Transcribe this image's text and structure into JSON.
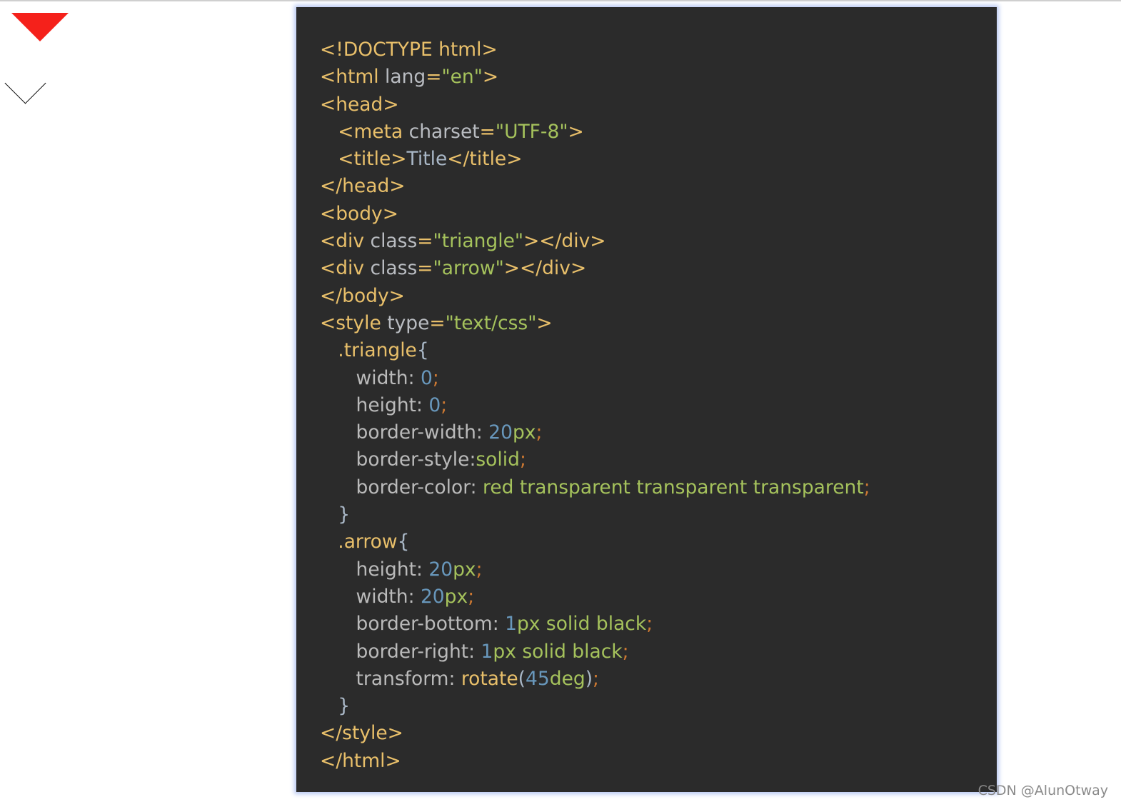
{
  "colors": {
    "triangle_fill": "#f5211b",
    "arrow_stroke": "#111111",
    "code_background": "#2b2b2b",
    "panel_glow": "#b9c9f3"
  },
  "preview": {
    "triangle_icon": "red-triangle-pointing-down",
    "arrow_icon": "chevron-down-outline"
  },
  "code": {
    "lines": [
      [
        {
          "t": "tag",
          "v": "<!DOCTYPE html>"
        }
      ],
      [
        {
          "t": "tag",
          "v": "<html "
        },
        {
          "t": "attr",
          "v": "lang"
        },
        {
          "t": "eq",
          "v": "="
        },
        {
          "t": "str",
          "v": "\"en\""
        },
        {
          "t": "tag",
          "v": ">"
        }
      ],
      [
        {
          "t": "tag",
          "v": "<head>"
        }
      ],
      [
        {
          "t": "tag",
          "v": "   <meta "
        },
        {
          "t": "attr",
          "v": "charset"
        },
        {
          "t": "eq",
          "v": "="
        },
        {
          "t": "str",
          "v": "\"UTF-8\""
        },
        {
          "t": "tag",
          "v": ">"
        }
      ],
      [
        {
          "t": "tag",
          "v": "   <title>"
        },
        {
          "t": "text",
          "v": "Title"
        },
        {
          "t": "tag",
          "v": "</title>"
        }
      ],
      [
        {
          "t": "tag",
          "v": "</head>"
        }
      ],
      [
        {
          "t": "tag",
          "v": "<body>"
        }
      ],
      [
        {
          "t": "tag",
          "v": "<div "
        },
        {
          "t": "attr",
          "v": "class"
        },
        {
          "t": "eq",
          "v": "="
        },
        {
          "t": "str",
          "v": "\"triangle\""
        },
        {
          "t": "tag",
          "v": "></div>"
        }
      ],
      [
        {
          "t": "tag",
          "v": "<div "
        },
        {
          "t": "attr",
          "v": "class"
        },
        {
          "t": "eq",
          "v": "="
        },
        {
          "t": "str",
          "v": "\"arrow\""
        },
        {
          "t": "tag",
          "v": "></div>"
        }
      ],
      [
        {
          "t": "tag",
          "v": "</body>"
        }
      ],
      [
        {
          "t": "tag",
          "v": "<style "
        },
        {
          "t": "attr",
          "v": "type"
        },
        {
          "t": "eq",
          "v": "="
        },
        {
          "t": "str",
          "v": "\"text/css\""
        },
        {
          "t": "tag",
          "v": ">"
        }
      ],
      [
        {
          "t": "sel",
          "v": "   .triangle"
        },
        {
          "t": "brace",
          "v": "{"
        }
      ],
      [
        {
          "t": "prop",
          "v": "      width: "
        },
        {
          "t": "num",
          "v": "0"
        },
        {
          "t": "semi",
          "v": ";"
        }
      ],
      [
        {
          "t": "prop",
          "v": "      height: "
        },
        {
          "t": "num",
          "v": "0"
        },
        {
          "t": "semi",
          "v": ";"
        }
      ],
      [
        {
          "t": "prop",
          "v": "      border-width: "
        },
        {
          "t": "num",
          "v": "20"
        },
        {
          "t": "unit",
          "v": "px"
        },
        {
          "t": "semi",
          "v": ";"
        }
      ],
      [
        {
          "t": "prop",
          "v": "      border-style:"
        },
        {
          "t": "val",
          "v": "solid"
        },
        {
          "t": "semi",
          "v": ";"
        }
      ],
      [
        {
          "t": "prop",
          "v": "      border-color: "
        },
        {
          "t": "val",
          "v": "red transparent transparent transparent"
        },
        {
          "t": "semi",
          "v": ";"
        }
      ],
      [
        {
          "t": "brace",
          "v": "   }"
        }
      ],
      [
        {
          "t": "sel",
          "v": "   .arrow"
        },
        {
          "t": "brace",
          "v": "{"
        }
      ],
      [
        {
          "t": "prop",
          "v": "      height: "
        },
        {
          "t": "num",
          "v": "20"
        },
        {
          "t": "unit",
          "v": "px"
        },
        {
          "t": "semi",
          "v": ";"
        }
      ],
      [
        {
          "t": "prop",
          "v": "      width: "
        },
        {
          "t": "num",
          "v": "20"
        },
        {
          "t": "unit",
          "v": "px"
        },
        {
          "t": "semi",
          "v": ";"
        }
      ],
      [
        {
          "t": "prop",
          "v": "      border-bottom: "
        },
        {
          "t": "num",
          "v": "1"
        },
        {
          "t": "val",
          "v": "px solid black"
        },
        {
          "t": "semi",
          "v": ";"
        }
      ],
      [
        {
          "t": "prop",
          "v": "      border-right: "
        },
        {
          "t": "num",
          "v": "1"
        },
        {
          "t": "val",
          "v": "px solid black"
        },
        {
          "t": "semi",
          "v": ";"
        }
      ],
      [
        {
          "t": "prop",
          "v": "      transform: "
        },
        {
          "t": "fn",
          "v": "rotate"
        },
        {
          "t": "brace",
          "v": "("
        },
        {
          "t": "num",
          "v": "45"
        },
        {
          "t": "unit",
          "v": "deg"
        },
        {
          "t": "brace",
          "v": ")"
        },
        {
          "t": "semi",
          "v": ";"
        }
      ],
      [
        {
          "t": "brace",
          "v": "   }"
        }
      ],
      [
        {
          "t": "tag",
          "v": "</style>"
        }
      ],
      [
        {
          "t": "tag",
          "v": "</html>"
        }
      ]
    ]
  },
  "watermark": "CSDN @AlunOtway"
}
